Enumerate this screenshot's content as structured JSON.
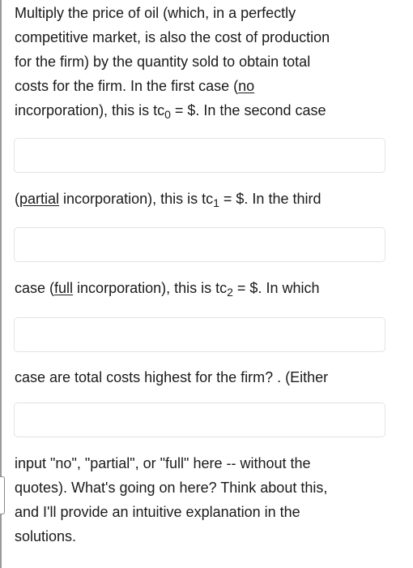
{
  "question": {
    "intro_lines": [
      "Multiply the price of oil (which, in a perfectly",
      "competitive market, is also the cost of production",
      "for the firm) by the quantity sold to obtain total",
      "costs for the firm.  In the first case ("
    ],
    "no_label": "no",
    "tc0_line": {
      "before": "incorporation), this is tc",
      "sub": "0",
      "after": " = $.  In the second case"
    },
    "tc1_line": {
      "open": "(",
      "underlined": "partial",
      "before": " incorporation), this is tc",
      "sub": "1",
      "after": " = $.  In the third"
    },
    "tc2_line": {
      "before": "case (",
      "underlined": "full",
      "middle": " incorporation), this is tc",
      "sub": "2",
      "after": " = $.  In which"
    },
    "highest_line": "case are total costs highest for the firm?  .  (Either",
    "closing_lines": [
      "input \"no\", \"partial\", or \"full\" here -- without the",
      "quotes).  What's going on here?  Think about this,",
      "and I'll provide an intuitive explanation in the",
      "solutions."
    ]
  },
  "inputs": {
    "tc0": {
      "value": "",
      "placeholder": ""
    },
    "tc1": {
      "value": "",
      "placeholder": ""
    },
    "tc2": {
      "value": "",
      "placeholder": ""
    },
    "highest_case": {
      "value": "",
      "placeholder": ""
    }
  }
}
